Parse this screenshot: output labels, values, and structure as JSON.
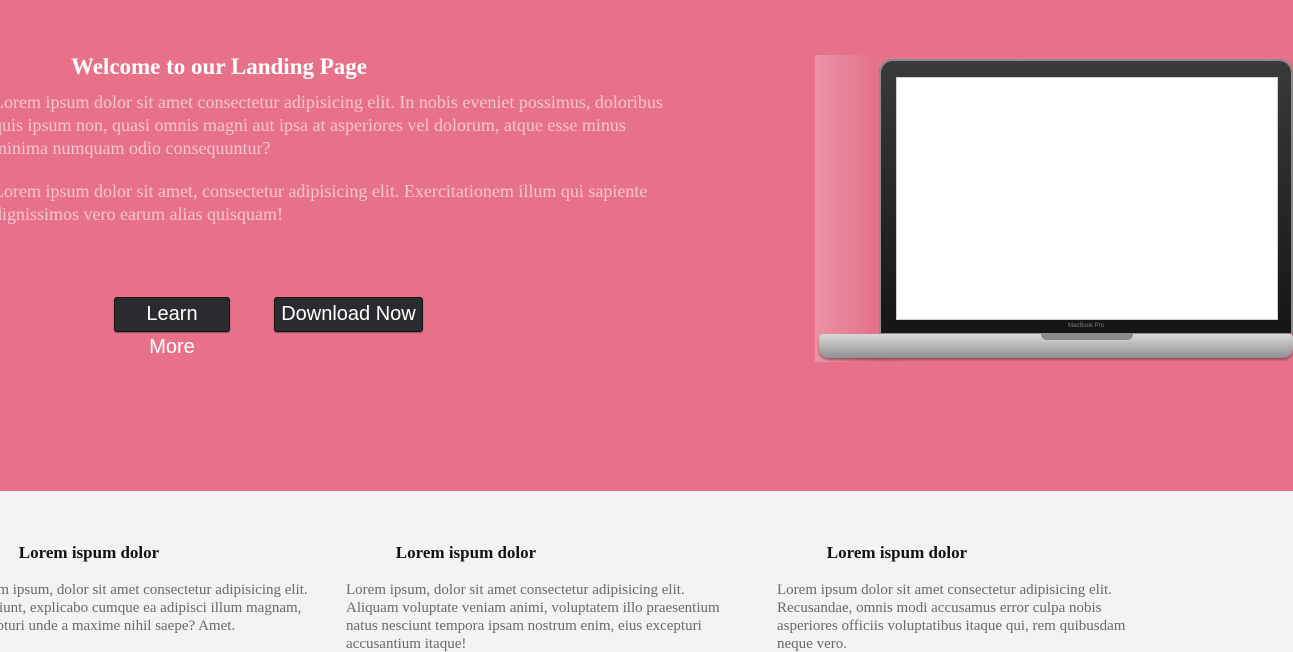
{
  "hero": {
    "title": "Welcome to our Landing Page",
    "paragraph1": "Lorem ipsum dolor sit amet consectetur adipisicing elit. In nobis eveniet possimus, doloribus quis ipsum non, quasi omnis magni aut ipsa at asperiores vel dolorum, atque esse minus minima numquam odio consequuntur?",
    "paragraph2": "Lorem ipsum dolor sit amet, consectetur adipisicing elit. Exercitationem illum qui sapiente dignissimos vero earum alias quisquam!",
    "learn_more_label": "Learn More",
    "download_now_label": "Download Now",
    "background_color": "#e8718a",
    "laptop": {
      "brand_text": "MacBook Pro"
    }
  },
  "features": {
    "background_color": "#f3f3f5",
    "items": [
      {
        "title": "Lorem ispum dolor",
        "text": "Lorem ipsum, dolor sit amet consectetur adipisicing elit. Nesciunt, explicabo cumque ea adipisci illum magnam, excepturi unde a maxime nihil saepe? Amet."
      },
      {
        "title": "Lorem ispum dolor",
        "text": "Lorem ipsum, dolor sit amet consectetur adipisicing elit. Aliquam voluptate veniam animi, voluptatem illo praesentium natus nesciunt tempora ipsam nostrum enim, eius excepturi accusantium itaque!"
      },
      {
        "title": "Lorem ispum dolor",
        "text": "Lorem ipsum dolor sit amet consectetur adipisicing elit. Recusandae, omnis modi accusamus error culpa nobis asperiores officiis voluptatibus itaque qui, rem quibusdam neque vero."
      }
    ]
  }
}
